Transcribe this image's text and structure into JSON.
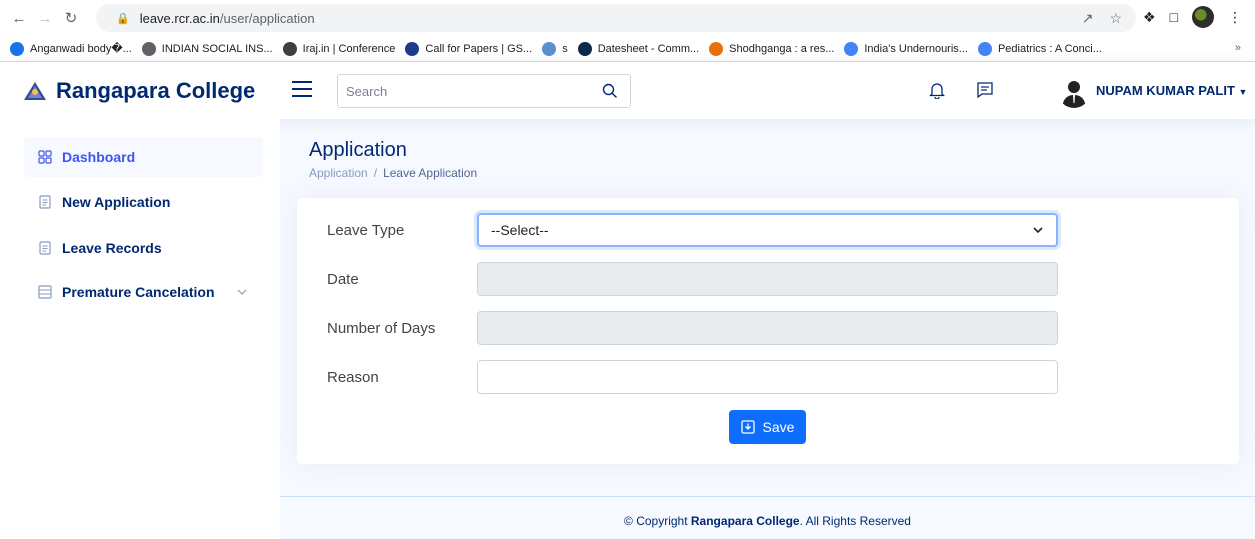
{
  "browser": {
    "url_host": "leave.rcr.ac.in",
    "url_path": "/user/application",
    "bookmarks": [
      {
        "label": "Anganwadi body�...",
        "icon": "globe-icon",
        "color": "#1a73e8"
      },
      {
        "label": "INDIAN SOCIAL INS...",
        "icon": "globe-icon",
        "color": "#5f6368"
      },
      {
        "label": "Iraj.in | Conference",
        "icon": "iraj-icon",
        "color": "#3c4043"
      },
      {
        "label": "Call for Papers | GS...",
        "icon": "un-icon",
        "color": "#1f3a8a"
      },
      {
        "label": "s",
        "icon": "site-icon",
        "color": "#5b8fd1"
      },
      {
        "label": "Datesheet - Comm...",
        "icon": "datesheet-icon",
        "color": "#0b2a4a"
      },
      {
        "label": "Shodhganga : a res...",
        "icon": "shodhganga-icon",
        "color": "#e8710a"
      },
      {
        "label": "India's Undernouris...",
        "icon": "google-icon",
        "color": "#4285f4"
      },
      {
        "label": "Pediatrics : A Conci...",
        "icon": "google-icon",
        "color": "#4285f4"
      }
    ],
    "more": "»"
  },
  "header": {
    "brand": "Rangapara College",
    "search_placeholder": "Search",
    "user_name": "NUPAM KUMAR PALIT"
  },
  "sidebar": {
    "items": [
      {
        "label": "Dashboard",
        "icon": "grid-icon"
      },
      {
        "label": "New Application",
        "icon": "document-icon"
      },
      {
        "label": "Leave Records",
        "icon": "document-icon"
      },
      {
        "label": "Premature Cancelation",
        "icon": "layout-icon"
      }
    ]
  },
  "main": {
    "title": "Application",
    "breadcrumb": [
      "Application",
      "/",
      "Leave Application"
    ],
    "form": {
      "leave_type_label": "Leave Type",
      "leave_type_value": "--Select--",
      "date_label": "Date",
      "days_label": "Number of Days",
      "reason_label": "Reason",
      "save_label": "Save"
    }
  },
  "footer": {
    "prefix": "© Copyright ",
    "brand": "Rangapara College",
    "suffix": ". All Rights Reserved"
  },
  "colors": {
    "brand": "#012970",
    "accent": "#4154f1",
    "primary_button": "#0d6efd"
  }
}
